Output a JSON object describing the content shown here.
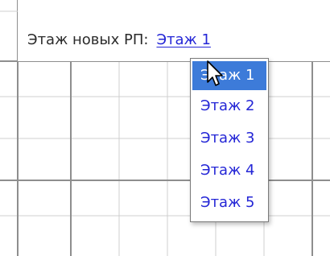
{
  "toolbar": {
    "floor_label": "Этаж новых РП:",
    "current_floor": "Этаж 1"
  },
  "dropdown": {
    "options": [
      "Этаж 1",
      "Этаж 2",
      "Этаж 3",
      "Этаж 4",
      "Этаж 5"
    ],
    "selected_index": 0
  },
  "colors": {
    "link": "#2426d6",
    "selected_bg": "#3d7bd9",
    "grid_thin": "#cfcfcf",
    "grid_thick": "#8e8e8e"
  },
  "icons": {
    "cursor": "arrow-cursor-icon"
  }
}
